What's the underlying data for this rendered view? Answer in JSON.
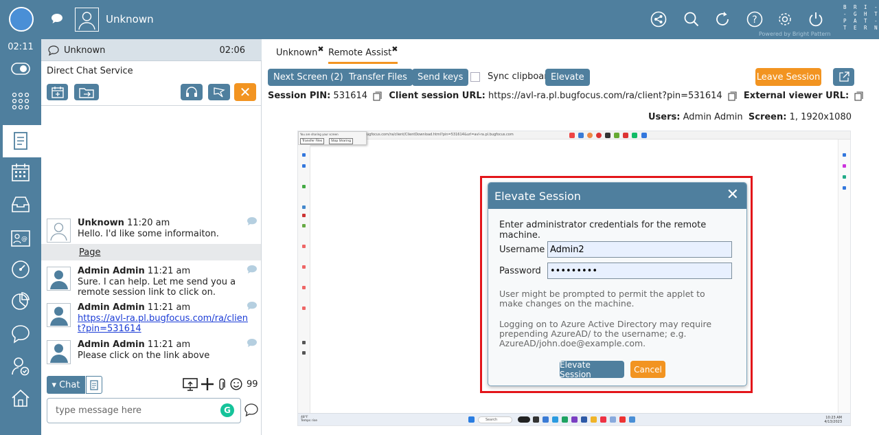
{
  "topbar": {
    "username": "Unknown",
    "brand": "B R I -\n- G H T\nP A T -\nT E R N",
    "powered_by": "Powered by Bright Pattern",
    "icons": [
      "chat-bubble-icon",
      "avatar-icon",
      "share-icon",
      "search-icon",
      "refresh-icon",
      "help-icon",
      "gear-icon",
      "power-icon"
    ]
  },
  "rail": {
    "timer": "02:11",
    "icons": [
      "toggle-icon",
      "apps-grid-icon",
      "documents-icon",
      "calendar-icon",
      "inbox-icon",
      "contacts-icon",
      "dashboard-icon",
      "reports-icon",
      "chat-icon",
      "agent-icon",
      "home-icon"
    ]
  },
  "conversation": {
    "header_name": "Unknown",
    "header_time": "02:06",
    "service": "Direct Chat Service",
    "messages": [
      {
        "sender": "Unknown",
        "time": "11:20 am",
        "text": "Hello. I'd like some informaiton."
      },
      {
        "sender": "Admin Admin",
        "time": "11:21 am",
        "text": "Sure. I can help. Let me send you a remote session link to click on."
      },
      {
        "sender": "Admin Admin",
        "time": "11:21 am",
        "link": "https://avl-ra.pl.bugfocus.com/ra/client?pin=531614"
      },
      {
        "sender": "Admin Admin",
        "time": "11:21 am",
        "text": "Please click on the link above"
      }
    ],
    "page_label": "Page",
    "chat_label": "Chat",
    "input_placeholder": "type message here",
    "grammarly": "G"
  },
  "main": {
    "tabs": [
      {
        "label": "Unknown",
        "mark": "✖"
      },
      {
        "label": "Remote Assist",
        "mark": "✖"
      }
    ],
    "buttons": {
      "next_screen": "Next Screen (2)",
      "transfer_files": "Transfer Files",
      "send_keys": "Send keys",
      "sync_clipboard": "Sync clipboard",
      "elevate": "Elevate",
      "leave_session": "Leave Session"
    },
    "session": {
      "pin_label": "Session PIN:",
      "pin": "531614",
      "client_url_label": "Client session URL:",
      "client_url": "https://avl-ra.pl.bugfocus.com/ra/client?pin=531614",
      "external_label": "External viewer URL:",
      "users_label": "Users:",
      "users": "Admin Admin",
      "screen_label": "Screen:",
      "screen": "1, 1920x1080"
    }
  },
  "remote": {
    "sharing_text": "You are sharing your screen",
    "transfer_files": "Transfer Files",
    "stop_sharing": "Stop Sharing",
    "url": "ugfocus.com/ra/client/ClientDownload.html?pin=531614&url=avl-ra.pl.bugfocus.com",
    "taskbar_search": "Search",
    "clock": "10:23 AM\n4/13/2023",
    "weather": "48°F\nTemps rise"
  },
  "dialog": {
    "title": "Elevate Session",
    "close": "✕",
    "instruction": "Enter administrator credentials for the remote machine.",
    "username_label": "Username",
    "username_value": "Admin2",
    "password_label": "Password",
    "password_value": "•••••••••",
    "note1": "User might be prompted to permit the applet to make changes on the machine.",
    "note2": "Logging on to Azure Active Directory may require prepending AzureAD/ to the username; e.g. AzureAD/john.doe@example.com.",
    "elevate_button": "Elevate Session",
    "cancel_button": "Cancel"
  }
}
